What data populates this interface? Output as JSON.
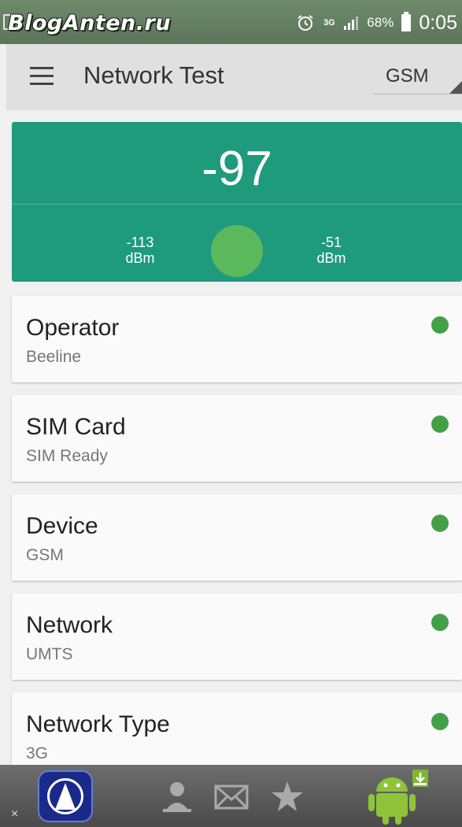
{
  "status_bar": {
    "watermark": "BlogAnten.ru",
    "network": "3G",
    "battery": "68%",
    "time": "0:05",
    "icons": [
      "alarm-icon",
      "signal-icon",
      "battery-icon"
    ]
  },
  "app_bar": {
    "title": "Network Test",
    "mode": "GSM",
    "menu_icon": "hamburger-menu-icon"
  },
  "signal": {
    "value": "-97",
    "min_value": "-113",
    "min_unit": "dBm",
    "max_value": "-51",
    "max_unit": "dBm",
    "color": "#1e9a7c",
    "indicator_color": "#5cb85c"
  },
  "cards": [
    {
      "title": "Operator",
      "value": "Beeline"
    },
    {
      "title": "SIM Card",
      "value": "SIM Ready"
    },
    {
      "title": "Device",
      "value": "GSM"
    },
    {
      "title": "Network",
      "value": "UMTS"
    },
    {
      "title": "Network Type",
      "value": "3G"
    }
  ],
  "status_color": "#43a047",
  "ad_bar": {
    "close": "×",
    "icons": [
      "app-icon",
      "person-icon",
      "mail-icon",
      "star-icon",
      "android-download-icon"
    ]
  }
}
